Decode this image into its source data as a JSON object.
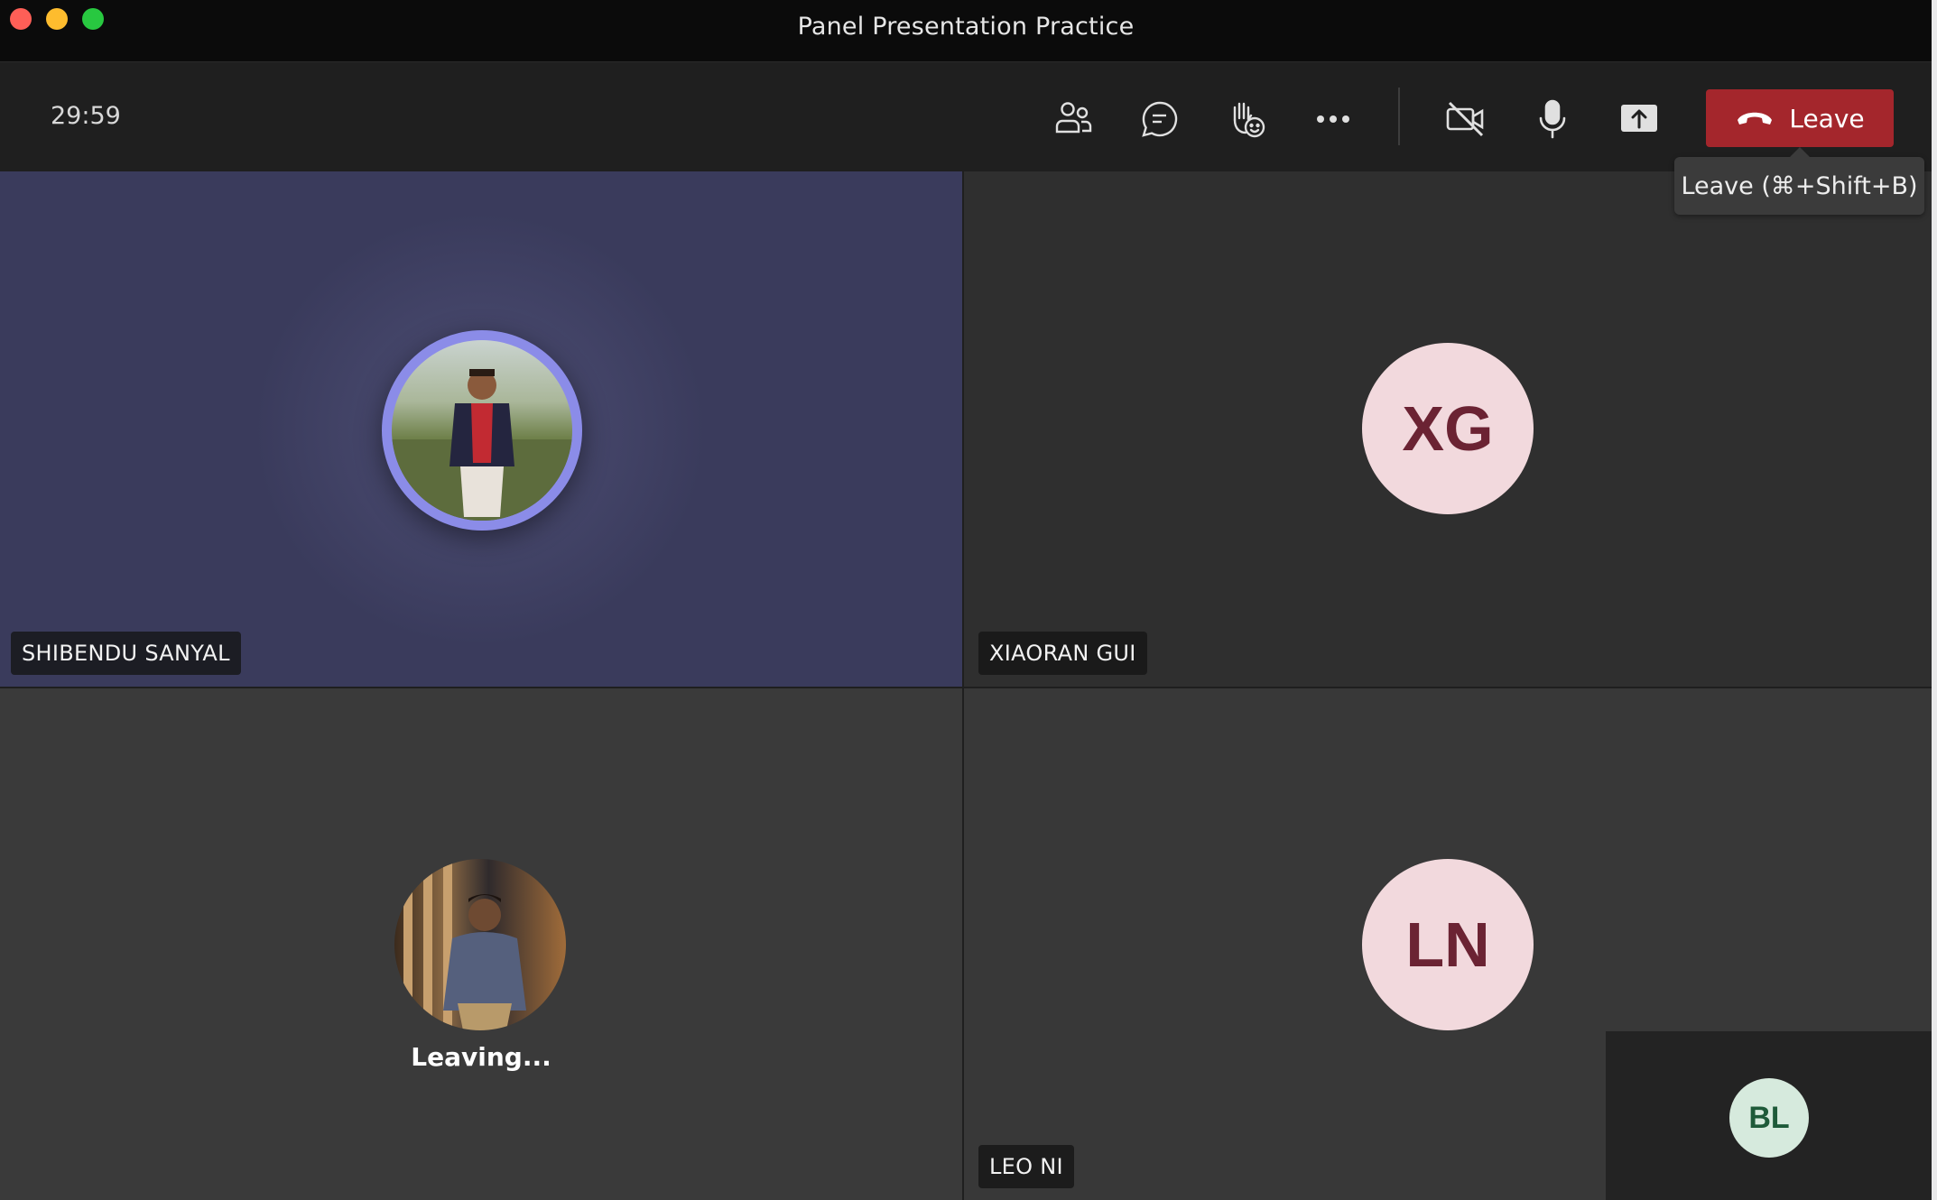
{
  "window": {
    "title": "Panel Presentation Practice"
  },
  "toolbar": {
    "timer": "29:59",
    "buttons": [
      {
        "name": "people",
        "icon": "people-icon"
      },
      {
        "name": "chat",
        "icon": "chat-icon"
      },
      {
        "name": "react",
        "icon": "raise-hand-icon"
      },
      {
        "name": "more",
        "icon": "more-icon"
      },
      {
        "name": "camera",
        "icon": "camera-off-icon"
      },
      {
        "name": "mic",
        "icon": "microphone-icon"
      },
      {
        "name": "share",
        "icon": "share-screen-icon"
      }
    ],
    "leave_label": "Leave",
    "leave_tooltip": "Leave (⌘+Shift+B)"
  },
  "participants": [
    {
      "name": "SHIBENDU SANYAL",
      "avatar": "photo",
      "speaking": true
    },
    {
      "name": "XIAORAN GUI",
      "initials": "XG"
    },
    {
      "name": "",
      "avatar": "photo",
      "status": "Leaving..."
    },
    {
      "name": "LEO NI",
      "initials": "LN"
    }
  ],
  "self_view": {
    "initials": "BL"
  },
  "colors": {
    "leave": "#a4262c",
    "speaking_ring": "#8b8ce8",
    "initials_bg": "#f2d9dd",
    "initials_text": "#6b2333",
    "self_bg": "#d6eadd",
    "self_text": "#1e5a39"
  }
}
